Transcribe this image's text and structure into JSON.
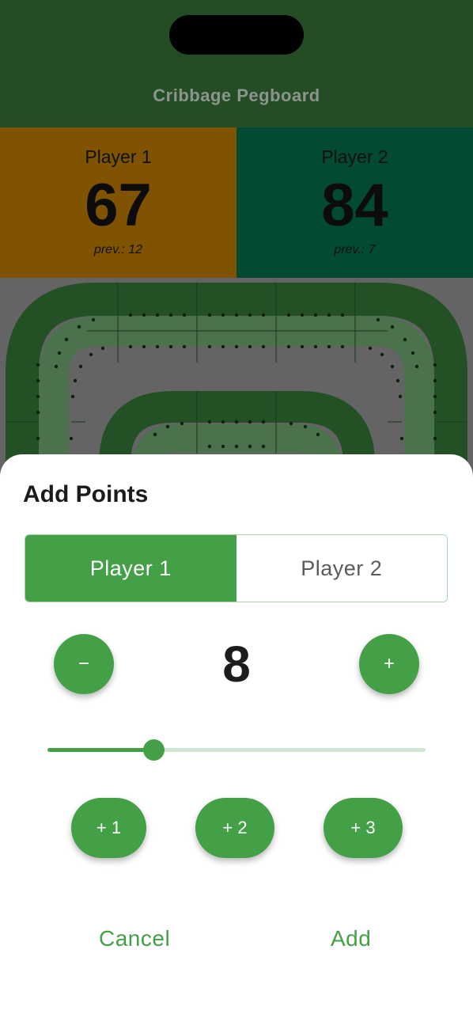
{
  "app": {
    "title": "Cribbage Pegboard"
  },
  "players": [
    {
      "name": "Player 1",
      "score": "67",
      "prev": "prev.: 12",
      "color": "#7f5300"
    },
    {
      "name": "Player 2",
      "score": "84",
      "prev": "prev.: 7",
      "color": "#024a34"
    }
  ],
  "sheet": {
    "title": "Add Points",
    "segments": [
      "Player 1",
      "Player 2"
    ],
    "selected_segment": "Player 1",
    "minus_label": "−",
    "plus_label": "+",
    "points_value": "8",
    "slider_fraction": 0.28,
    "quick_buttons": [
      "+ 1",
      "+ 2",
      "+ 3"
    ],
    "cancel_label": "Cancel",
    "add_label": "Add"
  },
  "colors": {
    "accent": "#43a047",
    "header": "#244d26"
  }
}
